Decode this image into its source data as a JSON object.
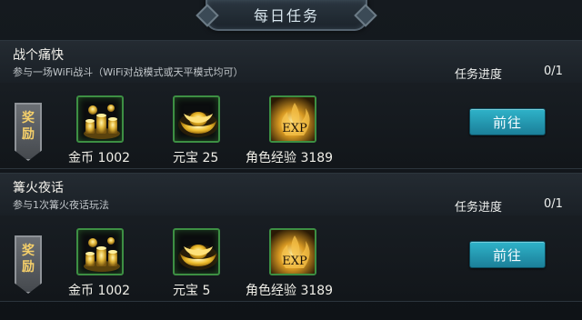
{
  "header": {
    "title": "每日任务"
  },
  "tasks": [
    {
      "name": "战个痛快",
      "description": "参与一场WiFi战斗（WiFi对战模式或天平模式均可）",
      "progress_label": "任务进度",
      "progress_value": "0/1",
      "reward_badge": [
        "奖",
        "励"
      ],
      "rewards": [
        {
          "icon": "gold-coins-icon",
          "label": "金币 1002"
        },
        {
          "icon": "yuanbao-icon",
          "label": "元宝 25"
        },
        {
          "icon": "exp-icon",
          "label": "角色经验 3189",
          "icon_text": "EXP"
        }
      ],
      "go_label": "前往"
    },
    {
      "name": "篝火夜话",
      "description": "参与1次篝火夜话玩法",
      "progress_label": "任务进度",
      "progress_value": "0/1",
      "reward_badge": [
        "奖",
        "励"
      ],
      "rewards": [
        {
          "icon": "gold-coins-icon",
          "label": "金币 1002"
        },
        {
          "icon": "yuanbao-icon",
          "label": "元宝 5"
        },
        {
          "icon": "exp-icon",
          "label": "角色经验 3189",
          "icon_text": "EXP"
        }
      ],
      "go_label": "前往"
    }
  ],
  "colors": {
    "accent_button": "#2fb3c9",
    "icon_border": "#3d8f43",
    "badge_text": "#f6d06a"
  }
}
